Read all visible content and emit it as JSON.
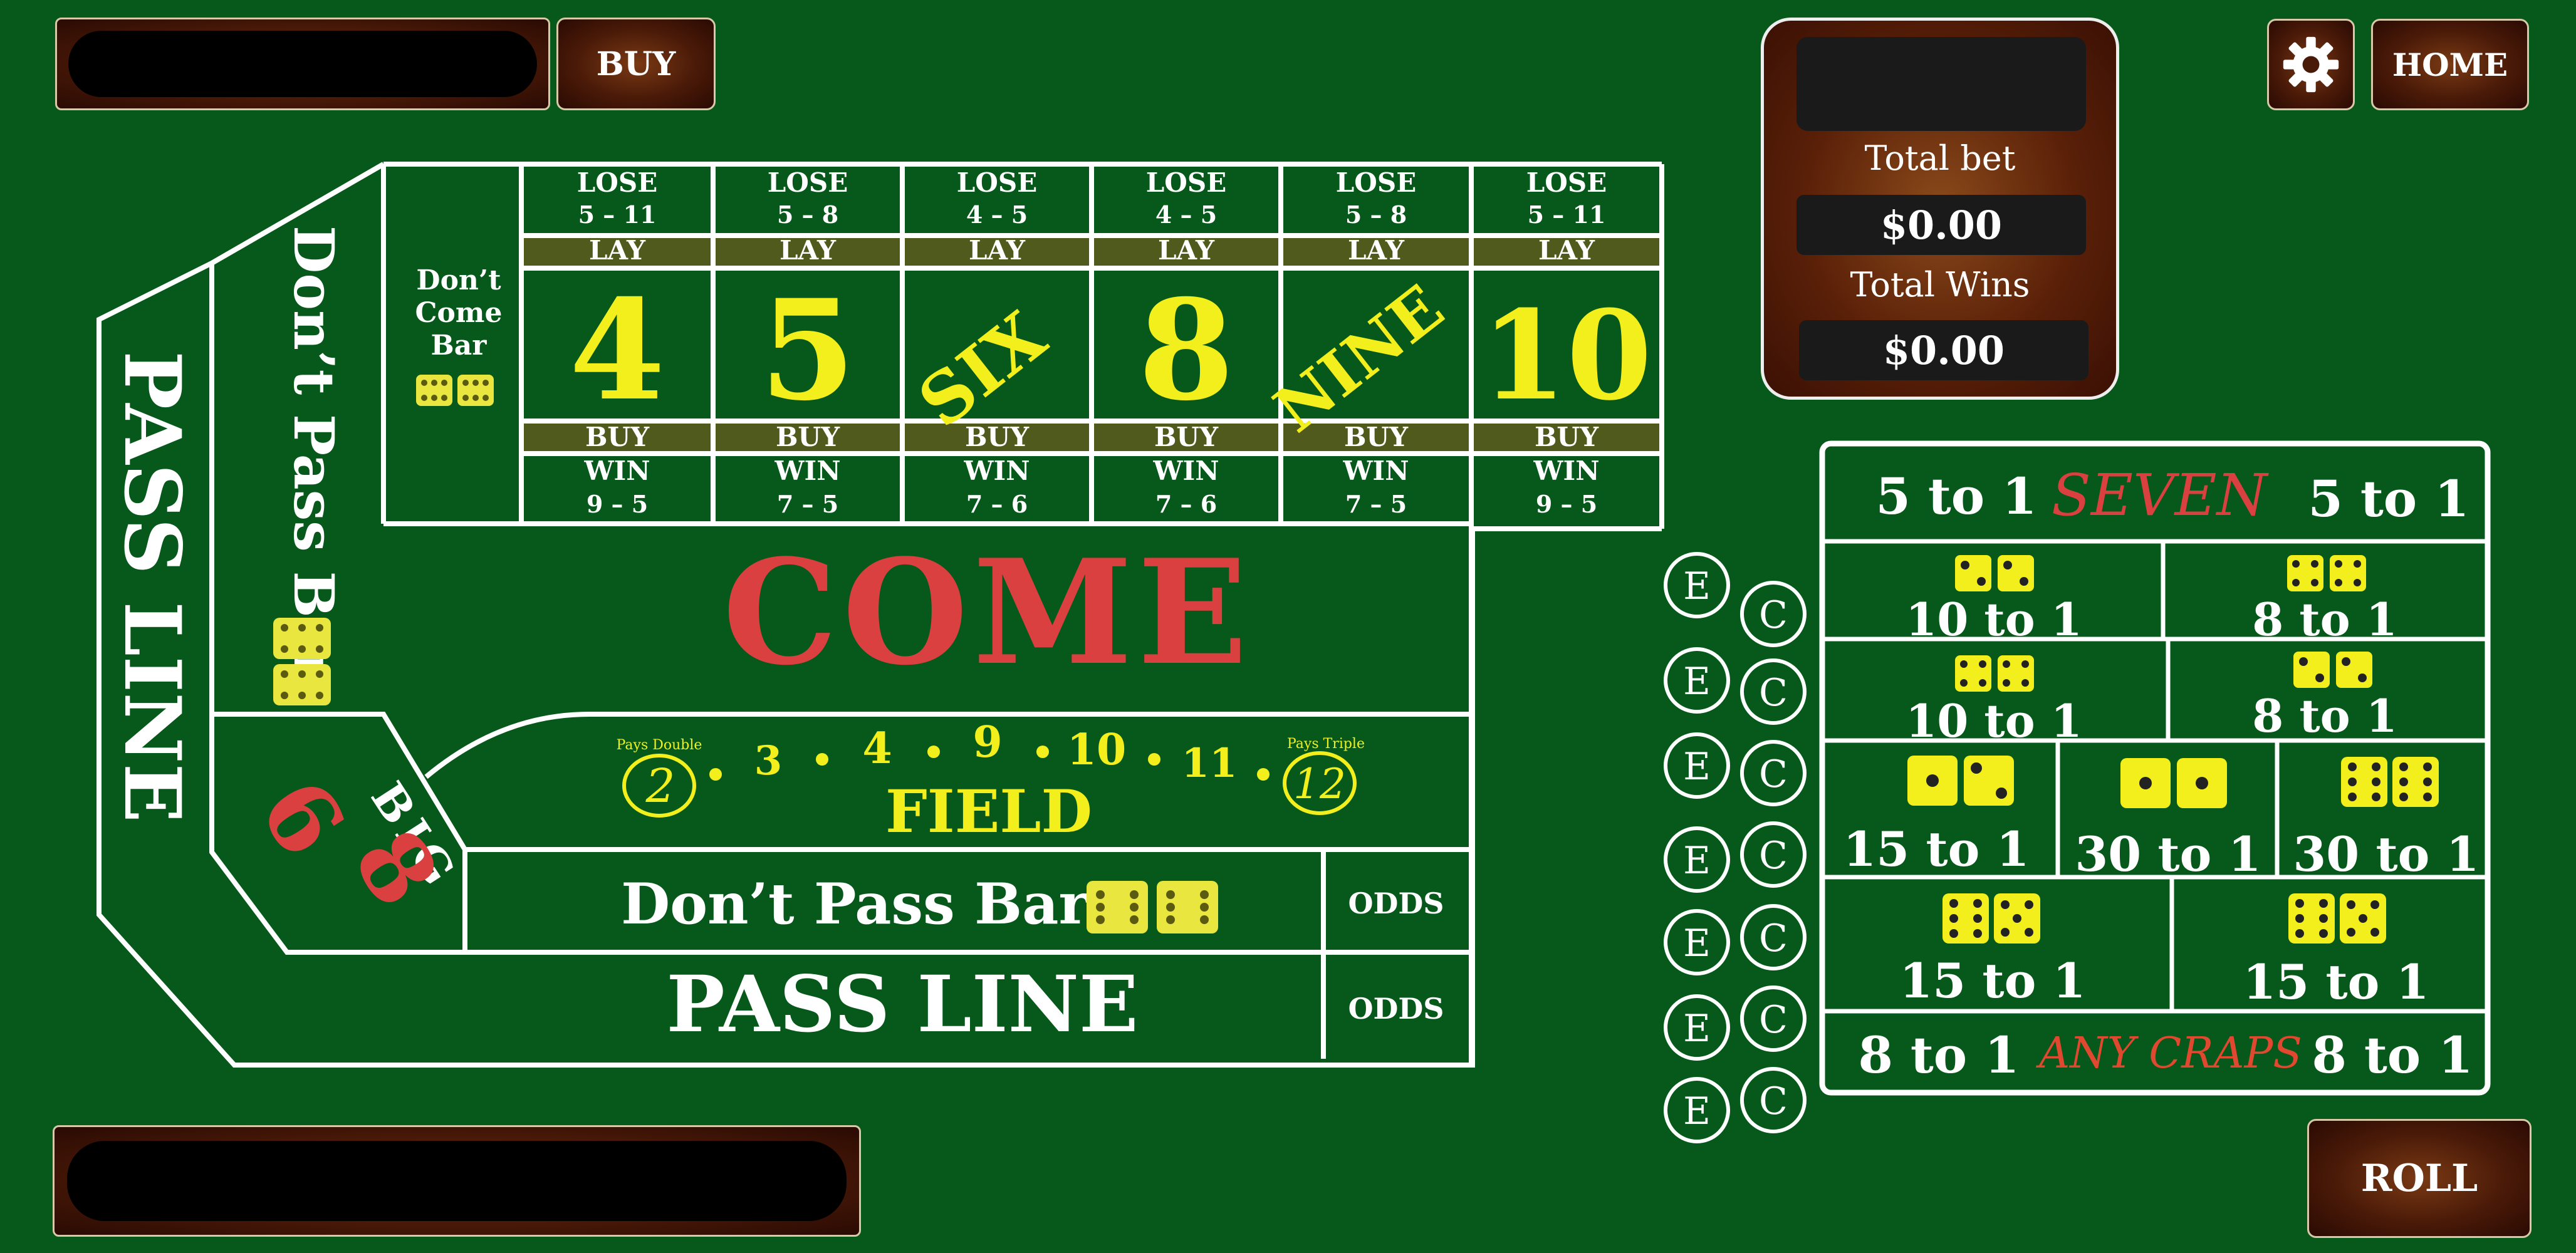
{
  "top_left": {
    "buy_label": "BUY"
  },
  "top_right": {
    "home_label": "HOME",
    "settings_icon": "gear-icon"
  },
  "bottom_right": {
    "roll_label": "ROLL"
  },
  "totals": {
    "total_bet_label": "Total bet",
    "total_bet_value": "$0.00",
    "total_wins_label": "Total Wins",
    "total_wins_value": "$0.00"
  },
  "colors": {
    "felt": "#06591a",
    "line": "#ffffff",
    "yellow": "#f2ef1c",
    "red": "#d9403f",
    "olive": "#4f5a1c"
  },
  "table": {
    "places": [
      {
        "lose": "LOSE",
        "lose_odds": "5 – 11",
        "lay": "LAY",
        "number": "4",
        "buy": "BUY",
        "win": "WIN",
        "win_odds": "9 – 5"
      },
      {
        "lose": "LOSE",
        "lose_odds": "5 – 8",
        "lay": "LAY",
        "number": "5",
        "buy": "BUY",
        "win": "WIN",
        "win_odds": "7 – 5"
      },
      {
        "lose": "LOSE",
        "lose_odds": "4 – 5",
        "lay": "LAY",
        "number": "SIX",
        "buy": "BUY",
        "win": "WIN",
        "win_odds": "7 – 6"
      },
      {
        "lose": "LOSE",
        "lose_odds": "4 – 5",
        "lay": "LAY",
        "number": "8",
        "buy": "BUY",
        "win": "WIN",
        "win_odds": "7 – 6"
      },
      {
        "lose": "LOSE",
        "lose_odds": "5 – 8",
        "lay": "LAY",
        "number": "NINE",
        "buy": "BUY",
        "win": "WIN",
        "win_odds": "7 – 5"
      },
      {
        "lose": "LOSE",
        "lose_odds": "5 – 11",
        "lay": "LAY",
        "number": "10",
        "buy": "BUY",
        "win": "WIN",
        "win_odds": "9 – 5"
      }
    ],
    "dont_come_bar": [
      "Don’t",
      "Come",
      "Bar"
    ],
    "come": "COME",
    "field": {
      "label": "FIELD",
      "pays_double": "Pays Double",
      "pays_triple": "Pays Triple",
      "n2": "2",
      "n3": "3",
      "n4": "4",
      "n9": "9",
      "n10": "10",
      "n11": "11",
      "n12": "12"
    },
    "dont_pass_bar": "Don’t Pass Bar",
    "dont_pass_bar_side": "Don’t Pass Bar",
    "pass_line": "PASS LINE",
    "pass_line_side": "PASS LINE",
    "odds": "ODDS",
    "big": "BIG",
    "big6": "6",
    "big8": "8"
  },
  "props": {
    "seven": {
      "left": "5 to 1",
      "label": "SEVEN",
      "right": "5 to 1"
    },
    "hard_row1": {
      "left": "10 to 1",
      "right": "8 to 1"
    },
    "hard_row2": {
      "left": "10 to 1",
      "right": "8 to 1"
    },
    "row3": {
      "a": "15 to 1",
      "b": "30 to 1",
      "c": "30 to 1"
    },
    "row4": {
      "a": "15 to 1",
      "b": "15 to 1"
    },
    "any_craps": {
      "left": "8 to 1",
      "label": "ANY CRAPS",
      "right": "8 to 1"
    },
    "e": "E",
    "c": "C"
  }
}
